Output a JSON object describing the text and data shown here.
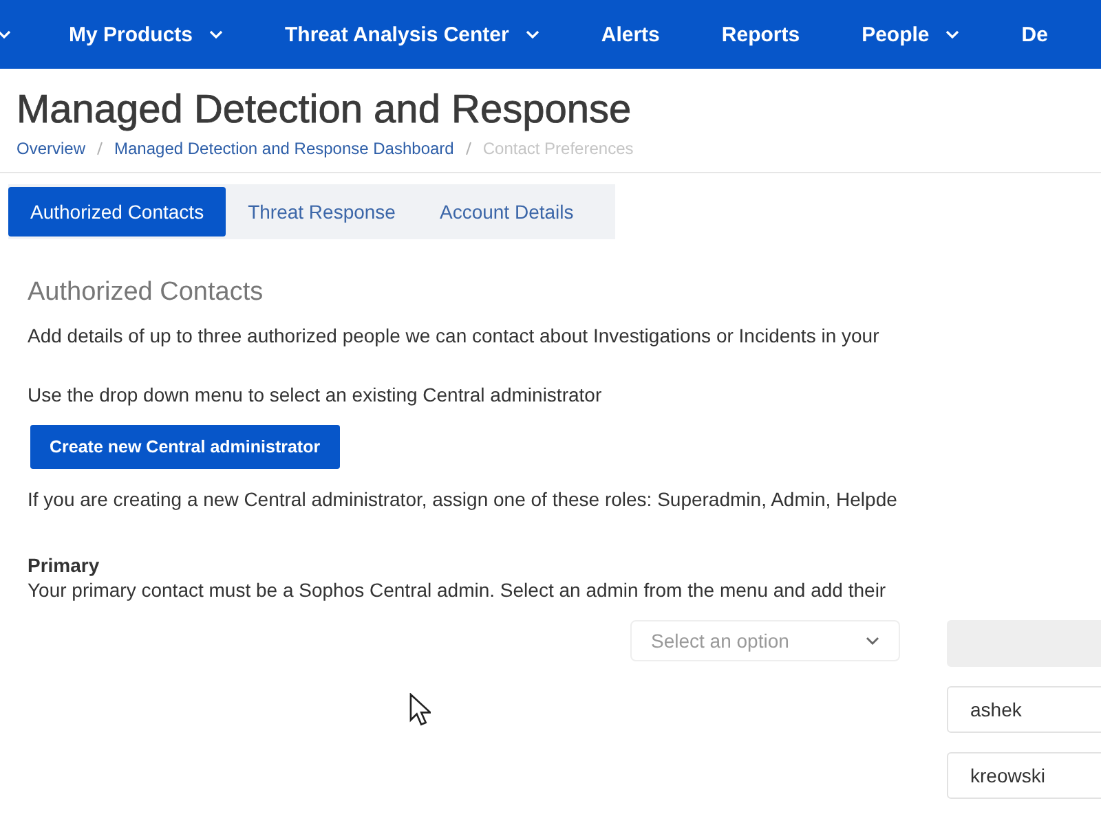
{
  "nav": {
    "items": [
      {
        "has_menu": true
      },
      {
        "label": "My Products",
        "has_menu": true
      },
      {
        "label": "Threat Analysis Center",
        "has_menu": true
      },
      {
        "label": "Alerts",
        "has_menu": false
      },
      {
        "label": "Reports",
        "has_menu": false
      },
      {
        "label": "People",
        "has_menu": true
      },
      {
        "label": "De",
        "has_menu": false
      }
    ]
  },
  "page": {
    "title": "Managed Detection and Response",
    "breadcrumbs": [
      {
        "label": "Overview",
        "current": false
      },
      {
        "label": "Managed Detection and Response Dashboard",
        "current": false
      },
      {
        "label": "Contact Preferences",
        "current": true
      }
    ]
  },
  "tabs": [
    {
      "label": "Authorized Contacts",
      "selected": true
    },
    {
      "label": "Threat Response",
      "selected": false
    },
    {
      "label": "Account Details",
      "selected": false
    }
  ],
  "section": {
    "heading": "Authorized Contacts",
    "intro": "Add details of up to three authorized people we can contact about Investigations or Incidents in your",
    "dropdown_hint": "Use the drop down menu to select an existing Central administrator",
    "create_button": "Create new Central administrator",
    "roles_note": "If you are creating a new Central administrator, assign one of these roles: Superadmin, Admin, Helpde"
  },
  "primary": {
    "heading": "Primary",
    "description": "Your primary contact must be a Sophos Central admin. Select an admin from the menu and add their",
    "select": {
      "placeholder": "Select an option"
    },
    "fields": [
      {
        "kind": "redacted"
      },
      {
        "kind": "text",
        "value": "ashek"
      },
      {
        "kind": "text",
        "value": "kreowski"
      }
    ]
  }
}
